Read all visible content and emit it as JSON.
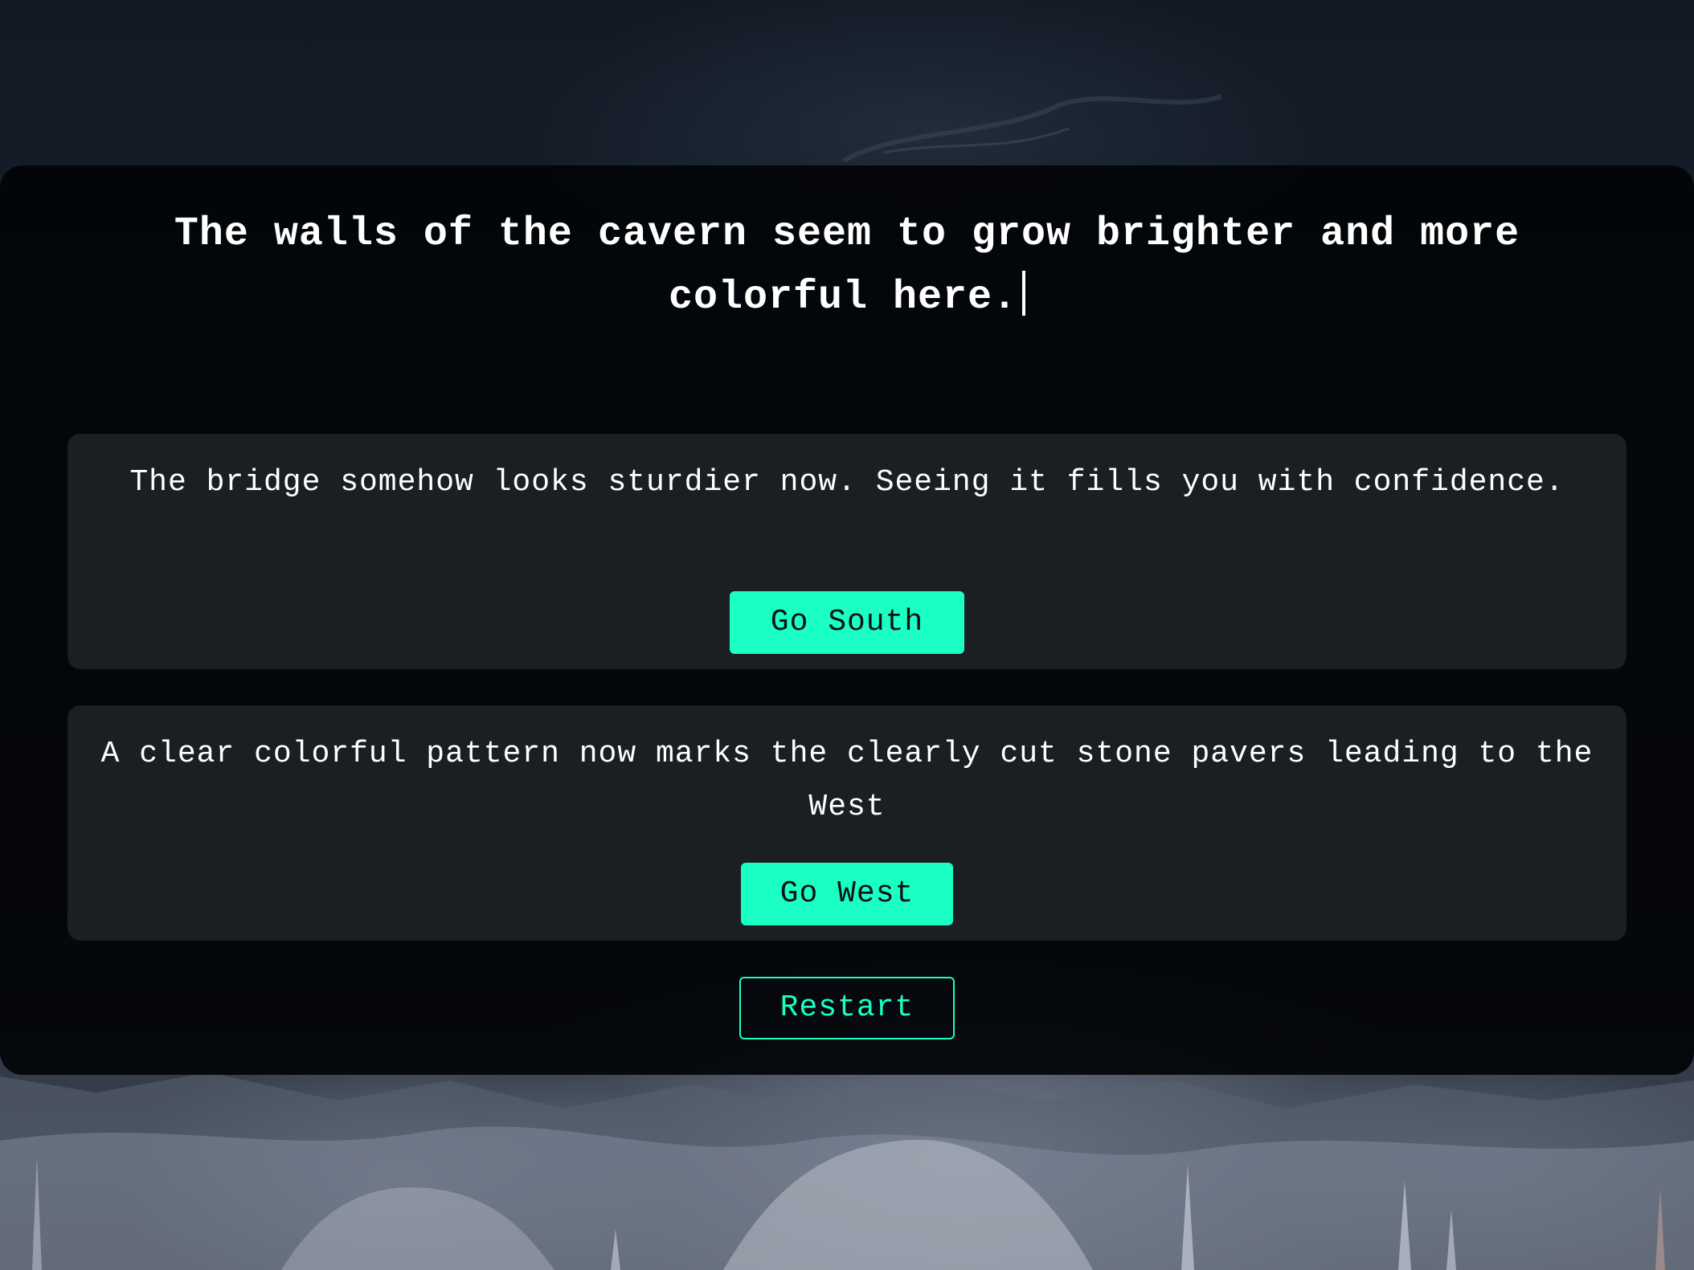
{
  "scene": {
    "description": "The walls of the cavern seem to grow brighter and more colorful here."
  },
  "options": [
    {
      "text": "The bridge somehow looks sturdier now. Seeing it fills you with confidence.",
      "button_label": "Go South"
    },
    {
      "text": "A clear colorful pattern now marks the clearly cut stone pavers leading to the West",
      "button_label": "Go West"
    }
  ],
  "controls": {
    "restart_label": "Restart"
  },
  "colors": {
    "accent": "#1affc4",
    "card_background": "#1b1f21",
    "panel_background": "#020408",
    "text": "#ffffff"
  }
}
